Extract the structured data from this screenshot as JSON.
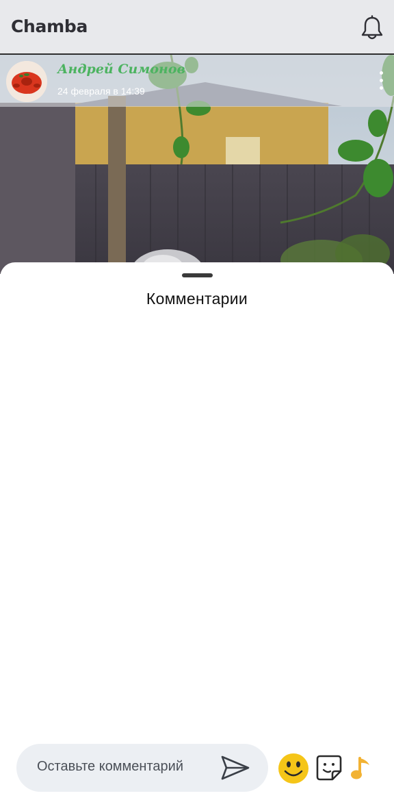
{
  "app": {
    "title": "Chamba"
  },
  "post": {
    "author": "Андрей Симонов",
    "date": "24 февраля в 14:39"
  },
  "comments": {
    "title": "Комментарии",
    "input_placeholder": "Оставьте комментарий"
  },
  "icons": {
    "notifications": "bell-icon",
    "menu": "more-vertical-icon",
    "send": "send-icon",
    "emoji": "emoji-icon",
    "sticker": "sticker-icon",
    "music": "music-note-icon"
  },
  "colors": {
    "author": "#4cb360",
    "emoji": "#f5c518",
    "music": "#f2b233",
    "appbar": "#e8e9ec"
  }
}
